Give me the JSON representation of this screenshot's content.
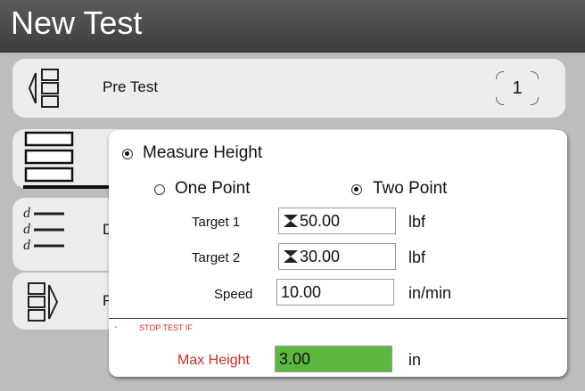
{
  "window": {
    "title": "New Test"
  },
  "steps": [
    {
      "label": "Pre Test",
      "badge": "1",
      "icon": "pre-test-icon"
    },
    {
      "label": "",
      "icon": "measure-height-icon"
    },
    {
      "label": "D",
      "icon": "data-icon"
    },
    {
      "label": "F",
      "icon": "post-test-icon"
    }
  ],
  "popup": {
    "measure_height": {
      "label": "Measure Height",
      "checked": true
    },
    "points": {
      "one": {
        "label": "One Point",
        "checked": false
      },
      "two": {
        "label": "Two Point",
        "checked": true
      }
    },
    "target1": {
      "label": "Target 1",
      "value": "50.00",
      "unit": "lbf"
    },
    "target2": {
      "label": "Target 2",
      "value": "30.00",
      "unit": "lbf"
    },
    "speed": {
      "label": "Speed",
      "value": "10.00",
      "unit": "in/min"
    },
    "stop_header": {
      "dash": "-",
      "label": "STOP TEST IF"
    },
    "max_height": {
      "label": "Max Height",
      "value": "3.00",
      "unit": "in"
    }
  },
  "colors": {
    "stop_red": "#d22b2b",
    "field_green": "#5db640",
    "titlebar": "#4a4a4a"
  }
}
